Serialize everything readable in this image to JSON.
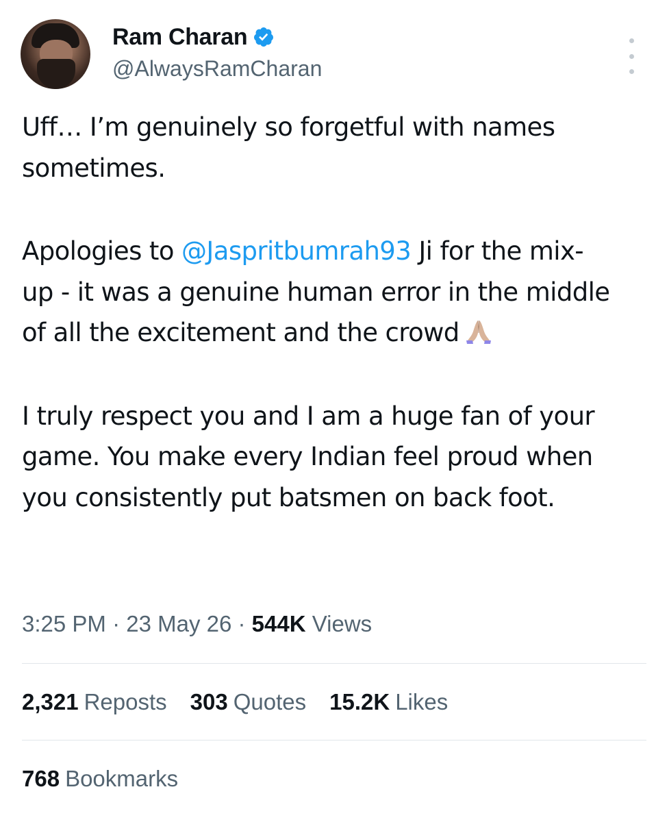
{
  "author": {
    "display_name": "Ram Charan",
    "handle": "@AlwaysRamCharan",
    "verified": true,
    "verified_color": "#1d9bf0"
  },
  "tweet": {
    "para1": "Uff… I’m genuinely so forgetful with names sometimes.",
    "para2_before": "Apologies to ",
    "para2_mention": "@Jaspritbumrah93",
    "para2_after": " Ji for the mix-up - it was a genuine human error in the middle of all the excitement and the crowd",
    "para2_emoji": "folded-hands",
    "para3": "I truly respect you and I am a huge fan of your game. You make every Indian feel proud when you consistently put batsmen on back foot."
  },
  "meta": {
    "time": "3:25 PM",
    "separator": " · ",
    "date": "23 May 26",
    "views_count": "544K",
    "views_label": "Views"
  },
  "stats": {
    "reposts_count": "2,321",
    "reposts_label": "Reposts",
    "quotes_count": "303",
    "quotes_label": "Quotes",
    "likes_count": "15.2K",
    "likes_label": "Likes",
    "bookmarks_count": "768",
    "bookmarks_label": "Bookmarks"
  },
  "colors": {
    "text_primary": "#0f1419",
    "text_secondary": "#536471",
    "link": "#1d9bf0",
    "divider": "#e1e6ea"
  }
}
